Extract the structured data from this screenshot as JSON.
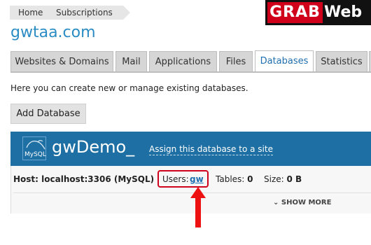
{
  "breadcrumb": {
    "home": "Home",
    "subscriptions": "Subscriptions"
  },
  "logo": {
    "part1": "GRAB",
    "part2": "Web"
  },
  "domain_title": "gwtaa.com",
  "tabs": [
    {
      "label": "Websites & Domains"
    },
    {
      "label": "Mail"
    },
    {
      "label": "Applications"
    },
    {
      "label": "Files"
    },
    {
      "label": "Databases"
    },
    {
      "label": "Statistics"
    }
  ],
  "description": "Here you can create new or manage existing databases.",
  "add_button": "Add Database",
  "database": {
    "icon_label": "MySQL",
    "name": "gwDemo_",
    "assign_link": "Assign this database to a site",
    "host": "Host: localhost:3306 (MySQL)",
    "users_label": "Users:",
    "users_value": "gw",
    "tables_label": "Tables:",
    "tables_value": "0",
    "size_label": "Size:",
    "size_value": "0 B",
    "show_more": "SHOW MORE"
  },
  "colors": {
    "accent": "#2b8cc4",
    "header": "#1e6fa3",
    "highlight": "#d0021b"
  }
}
